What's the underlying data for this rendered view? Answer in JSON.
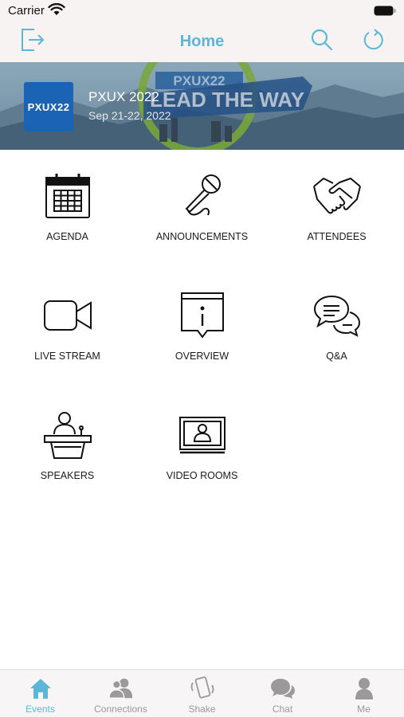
{
  "status_bar": {
    "carrier": "Carrier"
  },
  "nav": {
    "title": "Home"
  },
  "event": {
    "logo_text": "PXUX22",
    "name": "PXUX 2022",
    "dates": "Sep 21-22, 2022",
    "banner_text": "PXUX22 LEAD THE WAY"
  },
  "tiles": [
    {
      "label": "AGENDA",
      "icon": "calendar-icon"
    },
    {
      "label": "ANNOUNCEMENTS",
      "icon": "microphone-icon"
    },
    {
      "label": "ATTENDEES",
      "icon": "handshake-icon"
    },
    {
      "label": "LIVE STREAM",
      "icon": "video-camera-icon"
    },
    {
      "label": "OVERVIEW",
      "icon": "info-icon"
    },
    {
      "label": "Q&A",
      "icon": "chat-bubbles-icon"
    },
    {
      "label": "SPEAKERS",
      "icon": "podium-icon"
    },
    {
      "label": "VIDEO ROOMS",
      "icon": "video-room-icon"
    }
  ],
  "tab_bar": {
    "tabs": [
      {
        "label": "Events",
        "icon": "home-icon",
        "active": true
      },
      {
        "label": "Connections",
        "icon": "people-icon",
        "active": false
      },
      {
        "label": "Shake",
        "icon": "shake-phone-icon",
        "active": false
      },
      {
        "label": "Chat",
        "icon": "chat-icon",
        "active": false
      },
      {
        "label": "Me",
        "icon": "person-icon",
        "active": false
      }
    ]
  },
  "colors": {
    "accent": "#5bb6d8",
    "inactive": "#9a9a9a",
    "logo_blue": "#1b64b5"
  }
}
